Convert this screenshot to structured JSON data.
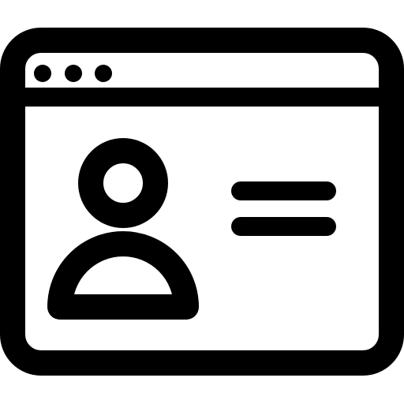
{
  "icon": {
    "name": "profile-browser-window-icon",
    "color": "#000000",
    "background": "#ffffff",
    "parts": {
      "window": "browser-window-frame",
      "dots": [
        "window-dot",
        "window-dot",
        "window-dot"
      ],
      "avatar": "user-avatar-icon",
      "lines": [
        "text-line",
        "text-line"
      ]
    }
  }
}
